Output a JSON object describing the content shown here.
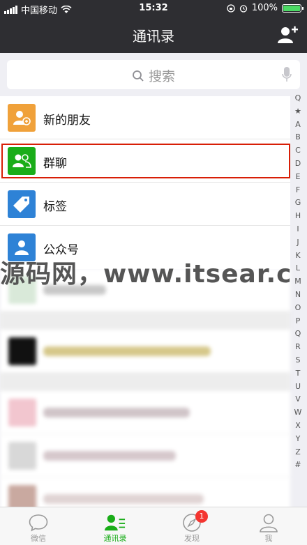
{
  "status": {
    "carrier": "中国移动",
    "time": "15:32",
    "battery": "100%",
    "battery_level": 1.0
  },
  "header": {
    "title": "通讯录",
    "add_icon": "add-friend-icon"
  },
  "search": {
    "placeholder": "搜索",
    "mic_icon": "mic-icon"
  },
  "contacts": {
    "items": [
      {
        "label": "新的朋友",
        "icon": "new-friend-icon",
        "color": "#f0a13a"
      },
      {
        "label": "群聊",
        "icon": "group-chat-icon",
        "color": "#1aad19"
      },
      {
        "label": "标签",
        "icon": "tag-icon",
        "color": "#2e82d6"
      },
      {
        "label": "公众号",
        "icon": "official-account-icon",
        "color": "#2e82d6"
      }
    ]
  },
  "watermark": "源码网，www.itsear.c",
  "index_letters": [
    "Q",
    "★",
    "A",
    "B",
    "C",
    "D",
    "E",
    "F",
    "G",
    "H",
    "I",
    "J",
    "K",
    "L",
    "M",
    "N",
    "O",
    "P",
    "Q",
    "R",
    "S",
    "T",
    "U",
    "V",
    "W",
    "X",
    "Y",
    "Z",
    "#"
  ],
  "tabs": [
    {
      "label": "微信",
      "icon": "chat-bubble-icon"
    },
    {
      "label": "通讯录",
      "icon": "contacts-icon",
      "active": true
    },
    {
      "label": "发现",
      "icon": "compass-icon",
      "badge": "1"
    },
    {
      "label": "我",
      "icon": "person-icon"
    }
  ],
  "colors": {
    "accent": "#1aad19",
    "navbar": "#2e2e32",
    "highlight": "#d81e06",
    "badge": "#f43530"
  }
}
